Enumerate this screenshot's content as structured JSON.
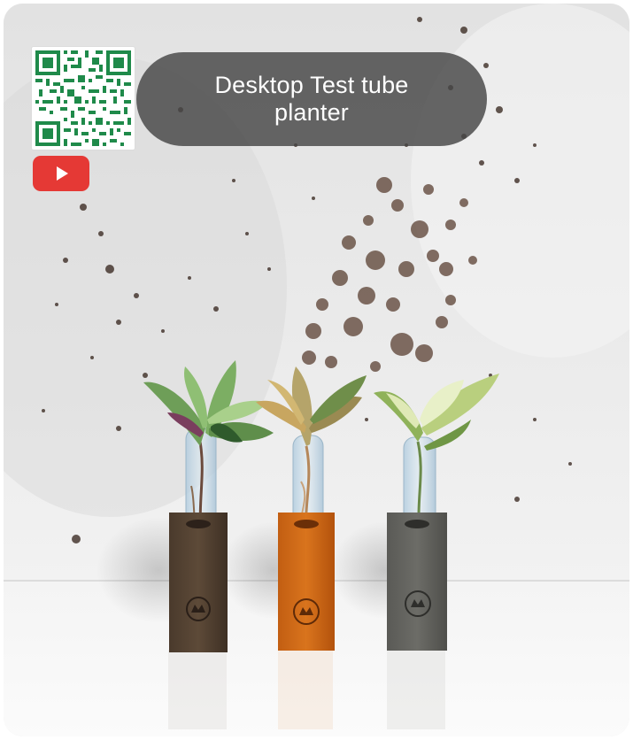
{
  "card": {
    "title": "Desktop Test tube planter"
  },
  "icons": {
    "qr": "qr-code-icon",
    "youtube": "youtube-play-icon"
  },
  "colors": {
    "youtube_red": "#e53935",
    "qr_green": "#1f8a4a",
    "title_pill_bg": "#464646",
    "title_text": "#ffffff"
  }
}
